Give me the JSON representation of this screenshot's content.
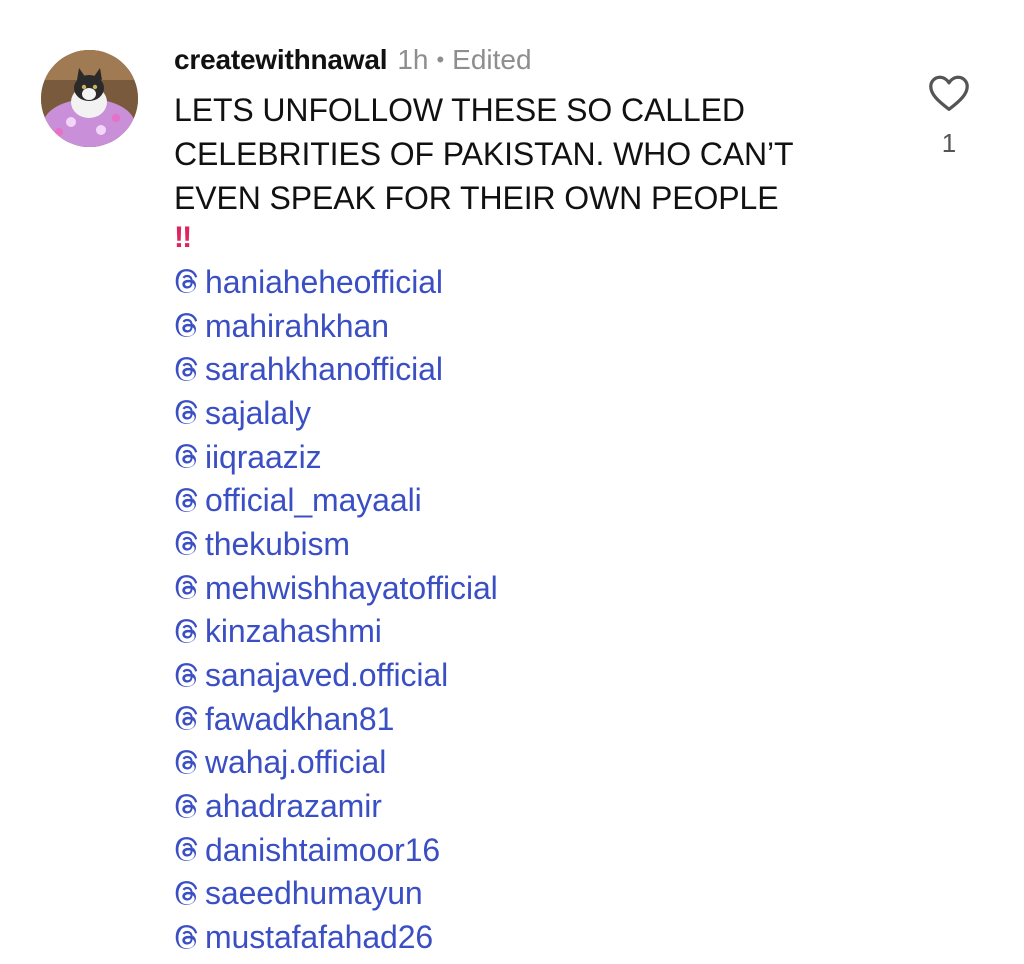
{
  "comment": {
    "avatar_icon": "cat-avatar",
    "username": "createwithnawal",
    "time": "1h",
    "separator": "•",
    "edited_label": "Edited",
    "text_lines": [
      "LETS UNFOLLOW THESE SO CALLED",
      "CELEBRITIES OF PAKISTAN. WHO CAN’T",
      "EVEN SPEAK FOR THEIR OWN PEOPLE"
    ],
    "emphasis_emoji": "‼",
    "mention_icon": "threads-icon",
    "mentions": [
      "haniaheheofficial",
      "mahirahkhan",
      "sarahkhanofficial",
      "sajalaly",
      "iiqraaziz",
      "official_mayaali",
      "thekubism",
      "mehwishhayatofficial",
      "kinzahashmi",
      "sanajaved.official",
      "fawadkhan81",
      "wahaj.official",
      "ahadrazamir",
      "danishtaimoor16",
      "saeedhumayun",
      "mustafafahad26"
    ],
    "like_icon": "heart-outline-icon",
    "like_count": "1"
  },
  "colors": {
    "mention": "#3b4fc4",
    "meta": "#8e8e8e",
    "emoji": "#e0245e"
  }
}
